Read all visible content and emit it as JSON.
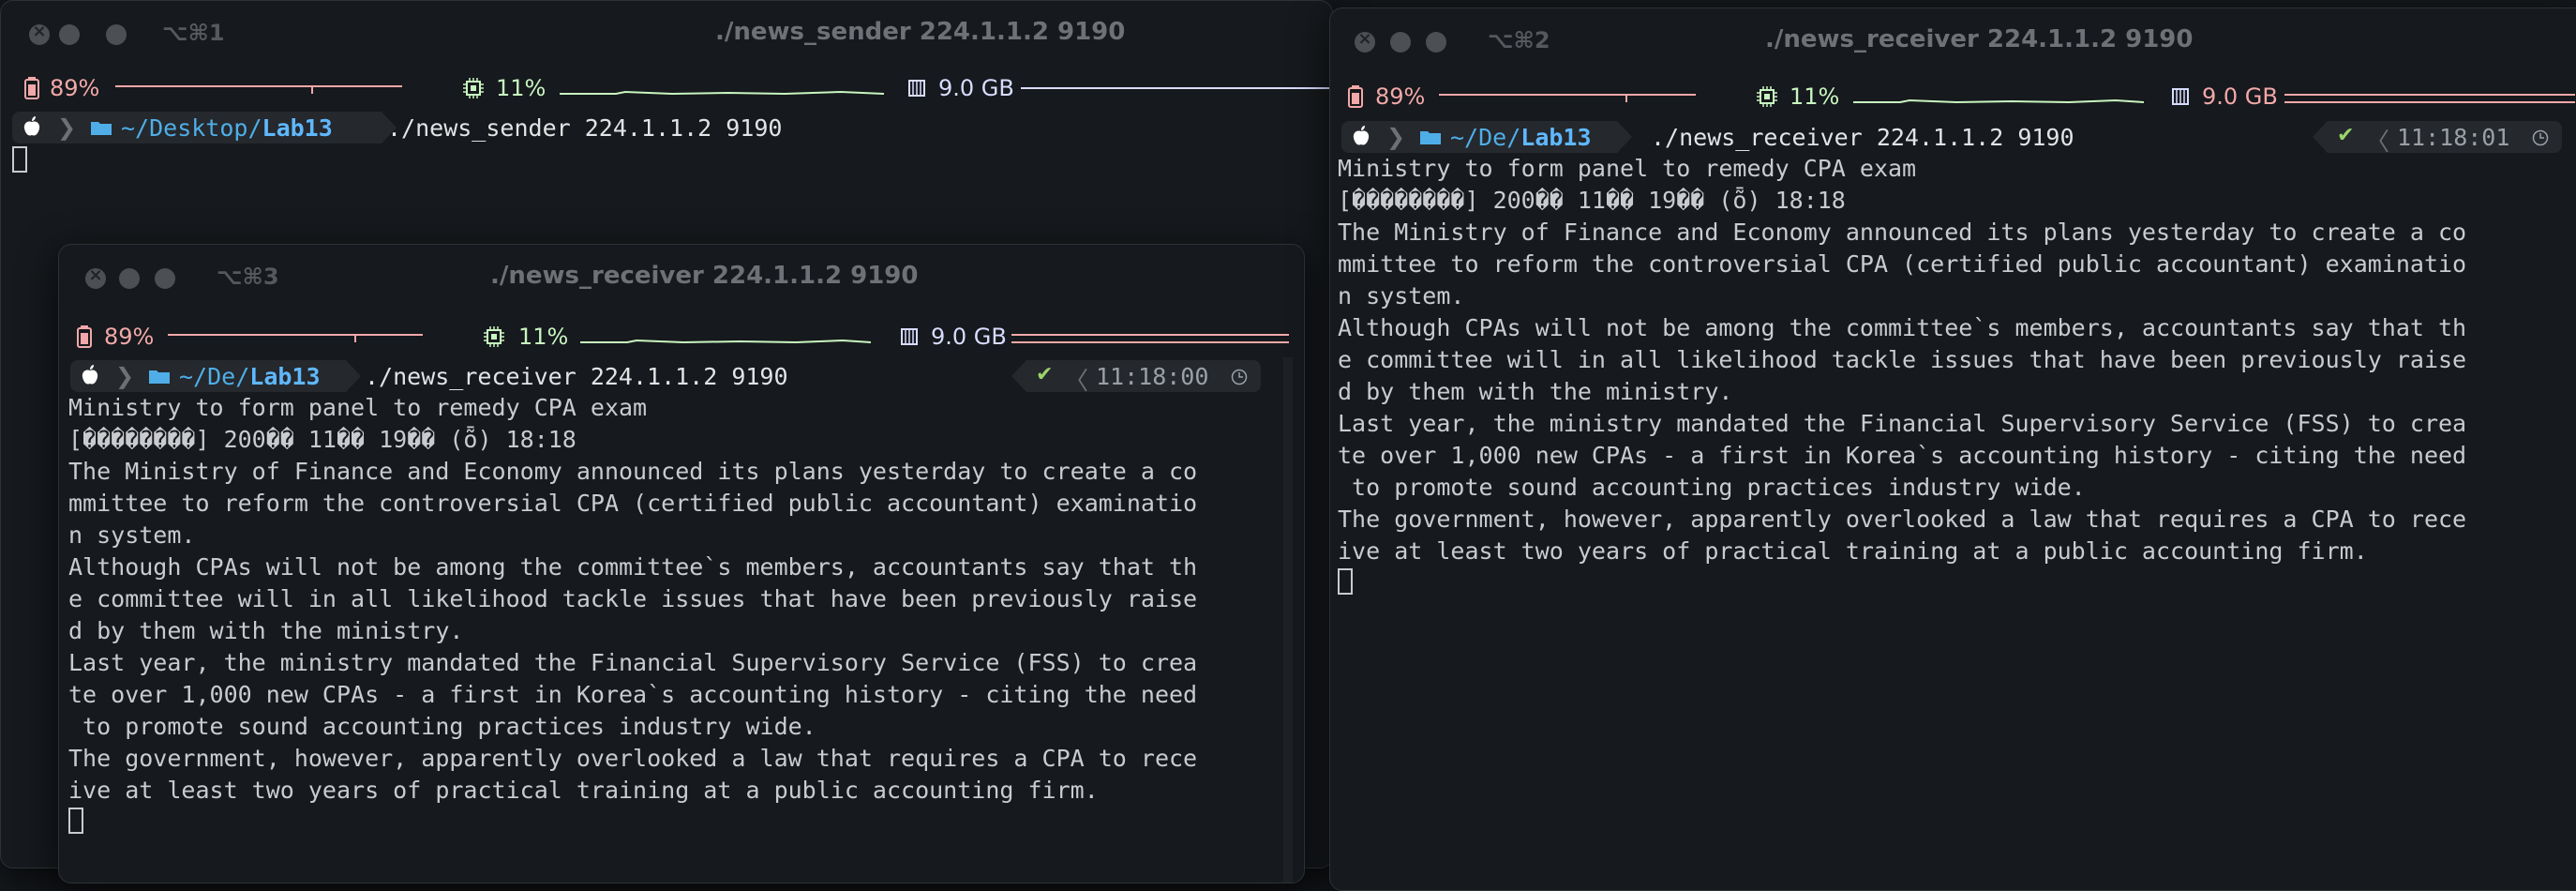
{
  "colors": {
    "background": "#15181c",
    "battery": "#f2a8a8",
    "cpu": "#c8f5c0",
    "memory": "#d8dcff",
    "path_dim": "#4faee8",
    "path_bold": "#5fb8ff",
    "check": "#9bd36b",
    "time": "#9aa0a6"
  },
  "icons": {
    "battery": "battery-icon",
    "cpu": "cpu-chip-icon",
    "memory": "memory-icon",
    "apple": "apple-logo-icon",
    "folder": "folder-icon",
    "check": "checkmark-icon",
    "clock": "clock-icon"
  },
  "sender_window": {
    "shortcut": "⌥⌘1",
    "title": "./news_sender 224.1.1.2 9190",
    "status": {
      "battery": "89%",
      "cpu": "11%",
      "memory": "9.0 GB"
    },
    "prompt": {
      "path_dim": "~/Desktop/",
      "path_bold": "Lab13",
      "command": "./news_sender 224.1.1.2 9190"
    }
  },
  "receiver_window_1": {
    "shortcut": "⌥⌘3",
    "title": "./news_receiver 224.1.1.2 9190",
    "status": {
      "battery": "89%",
      "cpu": "11%",
      "memory": "9.0 GB"
    },
    "prompt": {
      "path_dim": "~/De/",
      "path_bold": "Lab13",
      "command": "./news_receiver 224.1.1.2 9190",
      "check": "✔",
      "time": "11:18:00"
    },
    "output": "Ministry to form panel to remedy CPA exam\n[��������] 200�� 11�� 19�� (ȭ) 18:18\nThe Ministry of Finance and Economy announced its plans yesterday to create a co\nmmittee to reform the controversial CPA (certified public accountant) examinatio\nn system.\nAlthough CPAs will not be among the committee`s members, accountants say that th\ne committee will in all likelihood tackle issues that have been previously raise\nd by them with the ministry.\nLast year, the ministry mandated the Financial Supervisory Service (FSS) to crea\nte over 1,000 new CPAs - a first in Korea`s accounting history - citing the need\n to promote sound accounting practices industry wide.\nThe government, however, apparently overlooked a law that requires a CPA to rece\nive at least two years of practical training at a public accounting firm."
  },
  "receiver_window_2": {
    "shortcut": "⌥⌘2",
    "title": "./news_receiver 224.1.1.2 9190",
    "status": {
      "battery": "89%",
      "cpu": "11%",
      "memory": "9.0 GB"
    },
    "prompt": {
      "path_dim": "~/De/",
      "path_bold": "Lab13",
      "command": "./news_receiver 224.1.1.2 9190",
      "check": "✔",
      "time": "11:18:01"
    },
    "output": "Ministry to form panel to remedy CPA exam\n[��������] 200�� 11�� 19�� (ȭ) 18:18\nThe Ministry of Finance and Economy announced its plans yesterday to create a co\nmmittee to reform the controversial CPA (certified public accountant) examinatio\nn system.\nAlthough CPAs will not be among the committee`s members, accountants say that th\ne committee will in all likelihood tackle issues that have been previously raise\nd by them with the ministry.\nLast year, the ministry mandated the Financial Supervisory Service (FSS) to crea\nte over 1,000 new CPAs - a first in Korea`s accounting history - citing the need\n to promote sound accounting practices industry wide.\nThe government, however, apparently overlooked a law that requires a CPA to rece\nive at least two years of practical training at a public accounting firm."
  }
}
